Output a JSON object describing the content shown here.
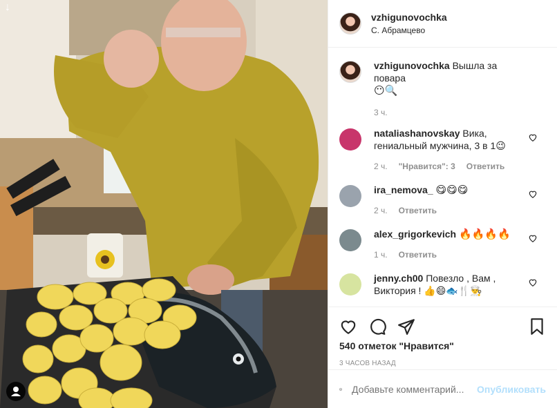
{
  "post": {
    "username": "vzhigunovochka",
    "location": "С. Абрамцево"
  },
  "caption": {
    "username": "vzhigunovochka",
    "text": "Вышла за повара",
    "emoji": "😶🔍",
    "time": "3 ч."
  },
  "comments": [
    {
      "username": "nataliashanovskay",
      "text": "Вика, гениальный мужчина, 3 в 1😉",
      "time": "2 ч.",
      "likes": "\"Нравится\": 3",
      "reply": "Ответить",
      "avatar_color": "#c8356b"
    },
    {
      "username": "ira_nemova_",
      "text": "😋😋😋",
      "time": "2 ч.",
      "likes": "",
      "reply": "Ответить",
      "avatar_color": "#9aa3ad"
    },
    {
      "username": "alex_grigorkevich",
      "text": "🔥🔥🔥🔥",
      "time": "1 ч.",
      "likes": "",
      "reply": "Ответить",
      "avatar_color": "#7b8a8e"
    },
    {
      "username": "jenny.ch00",
      "text": "Повезло , Вам , Виктория ! 👍😄🐟🍴👨‍🍳",
      "time": "",
      "likes": "",
      "reply": "",
      "avatar_color": "#d7e4a0"
    }
  ],
  "actions": {
    "likes": "540 отметок \"Нравится\"",
    "posted": "3 ЧАСОВ НАЗАД"
  },
  "composer": {
    "placeholder": "Добавьте комментарий...",
    "post_label": "Опубликовать"
  },
  "colors": {
    "text": "#262626",
    "muted": "#8e8e8e",
    "post_disabled": "#b2dffc",
    "border": "#efefef"
  }
}
